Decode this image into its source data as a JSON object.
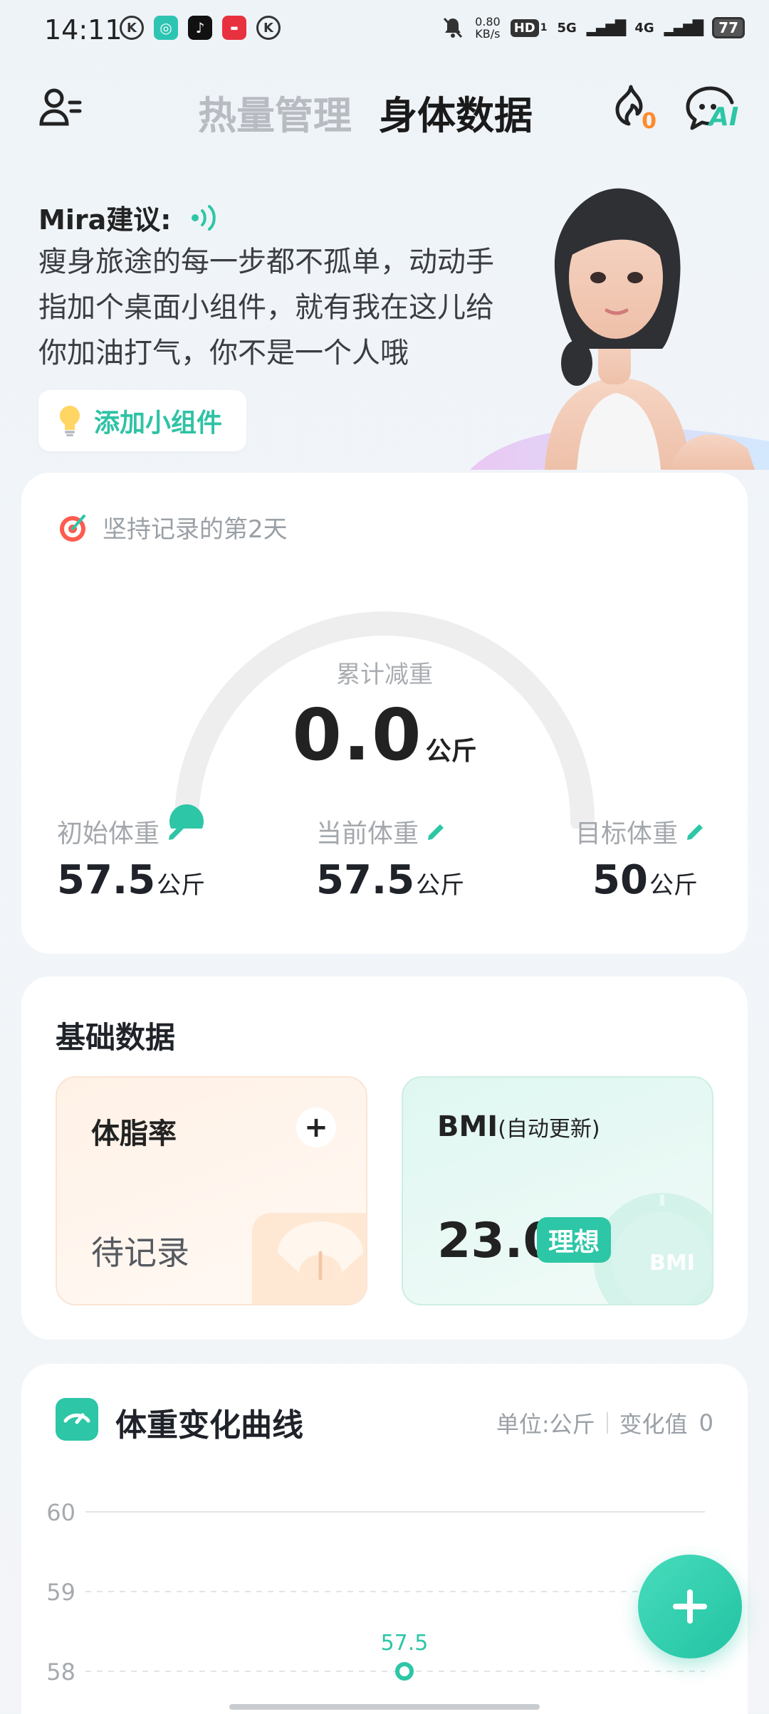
{
  "status_bar": {
    "time": "14:11",
    "net_speed_value": "0.80",
    "net_speed_unit": "KB/s",
    "hd": "HD",
    "hd_sub": "1",
    "sig1": "5G",
    "sig2": "4G",
    "battery": "77"
  },
  "header": {
    "tab_calorie": "热量管理",
    "tab_body": "身体数据",
    "flame_count": "0",
    "ai_label": "AI"
  },
  "hero": {
    "title": "Mira建议:",
    "message": "瘦身旅途的每一步都不孤单，动动手指加个桌面小组件，就有我在这儿给你加油打气，你不是一个人哦",
    "widget_button": "添加小组件"
  },
  "progress": {
    "streak": "坚持记录的第2天",
    "gauge_label": "累计减重",
    "lost_value": "0.0",
    "unit": "公斤",
    "initial_label": "初始体重",
    "initial_value": "57.5",
    "current_label": "当前体重",
    "current_value": "57.5",
    "target_label": "目标体重",
    "target_value": "50"
  },
  "basic": {
    "title": "基础数据",
    "bodyfat_title": "体脂率",
    "bodyfat_status": "待记录",
    "bmi_title": "BMI",
    "bmi_sub": "(自动更新)",
    "bmi_value": "23.0",
    "bmi_status": "理想",
    "bmi_deco_text": "BMI"
  },
  "weight_chart": {
    "title": "体重变化曲线",
    "unit_label": "单位:公斤",
    "change_label": "变化值",
    "change_value": "0"
  },
  "chart_data": {
    "type": "line",
    "y_ticks": [
      "60",
      "59",
      "58"
    ],
    "ylim": [
      58,
      60
    ],
    "points": [
      {
        "value": 57.5,
        "label": "57.5"
      }
    ]
  },
  "colors": {
    "accent": "#2dc6a6",
    "flame": "#ff8a2a"
  }
}
